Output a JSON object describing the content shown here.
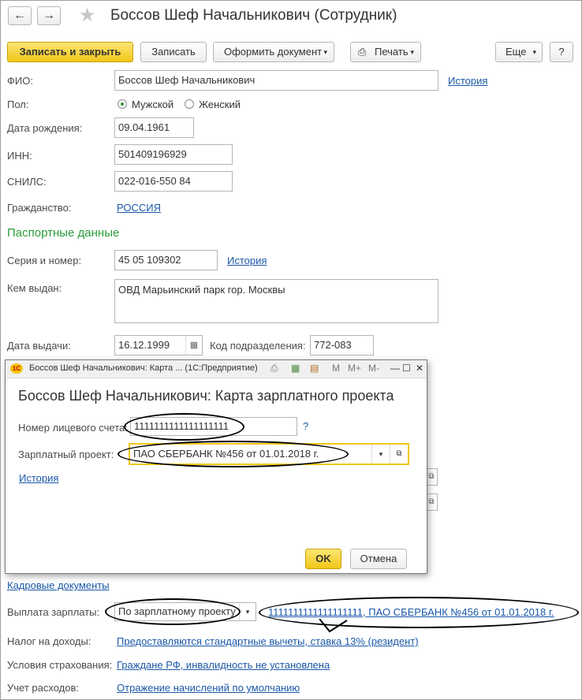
{
  "window": {
    "title": "Боссов Шеф Начальникович (Сотрудник)"
  },
  "toolbar": {
    "save_close": "Записать и закрыть",
    "save": "Записать",
    "create_doc": "Оформить документ",
    "print": "Печать",
    "more": "Еще",
    "help": "?"
  },
  "form": {
    "fio_label": "ФИО:",
    "fio_value": "Боссов Шеф Начальникович",
    "history": "История",
    "gender_label": "Пол:",
    "gender_male": "Мужской",
    "gender_female": "Женский",
    "gender_selected": "Мужской",
    "birth_label": "Дата рождения:",
    "birth_value": "09.04.1961",
    "inn_label": "ИНН:",
    "inn_value": "501409196929",
    "snils_label": "СНИЛС:",
    "snils_value": "022-016-550 84",
    "citizenship_label": "Гражданство:",
    "citizenship_value": "РОССИЯ",
    "passport_section": "Паспортные данные",
    "series_label": "Серия и номер:",
    "series_value": "45 05 109302",
    "issued_by_label": "Кем выдан:",
    "issued_by_value": "ОВД Марьинский парк гор. Москвы",
    "issue_date_label": "Дата выдачи:",
    "issue_date_value": "16.12.1999",
    "dept_code_label": "Код подразделения:",
    "dept_code_value": "772-083",
    "hr_docs": "Кадровые документы",
    "salary_label": "Выплата зарплаты:",
    "salary_value": "По зарплатному проекту",
    "salary_link": "1111111111111111111, ПАО СБЕРБАНК №456       от 01.01.2018 г.",
    "tax_label": "Налог на доходы:",
    "tax_value": "Предоставляются стандартные вычеты, ставка 13% (резидент)",
    "insurance_label": "Условия страхования:",
    "insurance_value": "Граждане РФ, инвалидность не установлена",
    "expense_label": "Учет расходов:",
    "expense_value": "Отражение начислений по умолчанию"
  },
  "modal": {
    "window_title": "Боссов Шеф Начальникович: Карта ... (1С:Предприятие)",
    "heading": "Боссов Шеф Начальникович: Карта зарплатного проекта",
    "account_label": "Номер лицевого счета:",
    "account_value": "1111111111111111111",
    "account_help": "?",
    "project_label": "Зарплатный проект:",
    "project_value": "ПАО СБЕРБАНК №456       от 01.01.2018 г.",
    "history": "История",
    "ok": "OK",
    "cancel": "Отмена",
    "tb_m": "M",
    "tb_mplus": "M+",
    "tb_mminus": "M-"
  },
  "colors": {
    "accent_yellow": "#f2c618",
    "link_blue": "#1a58a8",
    "section_green": "#2a9b3a"
  }
}
